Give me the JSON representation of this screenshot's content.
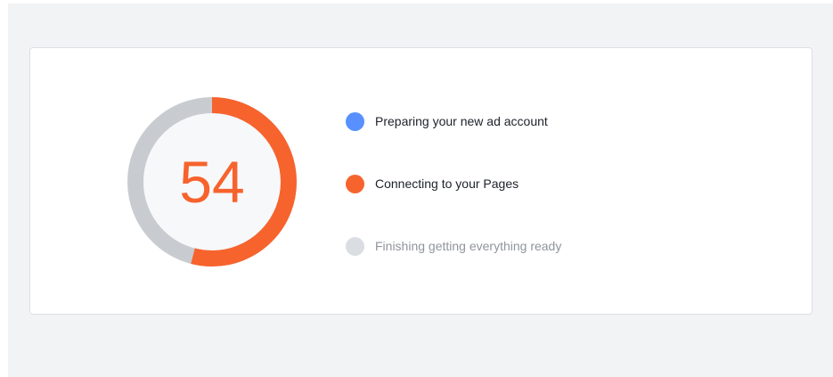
{
  "progress": {
    "value_text": "54",
    "fraction": 0.54,
    "colors": {
      "filled": "#f7632d",
      "remaining": "#c8ccd0",
      "inner_bg": "#f7f8fa"
    }
  },
  "steps": [
    {
      "label": "Preparing your new ad account",
      "state": "complete",
      "dot_color": "#5890ff",
      "text_color": "#1d2129"
    },
    {
      "label": "Connecting to your Pages",
      "state": "in-progress",
      "dot_color": "#f7632d",
      "text_color": "#1d2129"
    },
    {
      "label": "Finishing getting everything ready",
      "state": "pending",
      "dot_color": "#dadde1",
      "text_color": "#90949c"
    }
  ]
}
